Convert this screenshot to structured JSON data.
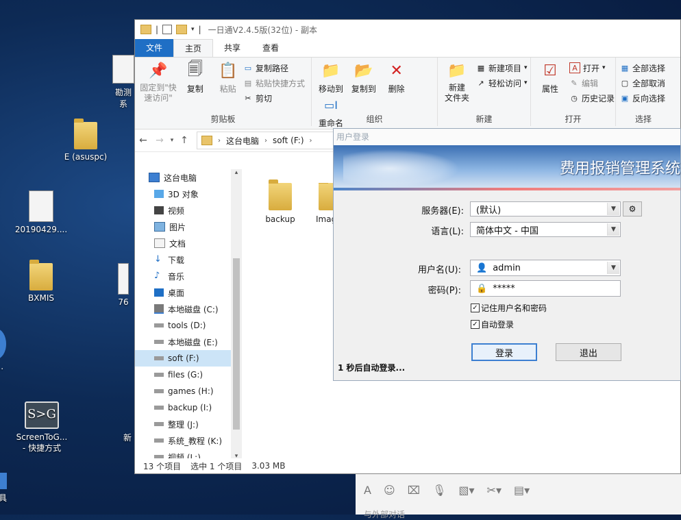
{
  "desktop": {
    "icons": [
      {
        "label": "勘测\n系",
        "kind": "partial"
      },
      {
        "label": "E (asuspc)",
        "kind": "folder"
      },
      {
        "label": "20190429....",
        "kind": "document"
      },
      {
        "label": "BXMIS",
        "kind": "folder"
      },
      {
        "label": "76",
        "kind": "partial"
      },
      {
        "label": "w...",
        "kind": "partial"
      },
      {
        "label": "ScreenToG...\n- 快捷方式",
        "kind": "app"
      },
      {
        "label": "新",
        "kind": "partial"
      },
      {
        "label": "具",
        "kind": "partial"
      }
    ]
  },
  "explorer": {
    "title": "一日通V2.4.5版(32位) - 副本",
    "tabs": [
      "文件",
      "主页",
      "共享",
      "查看"
    ],
    "ribbon": {
      "pin": "固定到\"快\n速访问\"",
      "copy": "复制",
      "paste": "粘贴",
      "copy_path": "复制路径",
      "paste_shortcut": "粘贴快捷方式",
      "cut": "剪切",
      "clipboard": "剪贴板",
      "move_to": "移动到",
      "copy_to": "复制到",
      "delete": "删除",
      "rename": "重命名",
      "organize": "组织",
      "new_folder": "新建\n文件夹",
      "new_item": "新建项目",
      "easy_access": "轻松访问",
      "new_group": "新建",
      "properties": "属性",
      "open": "打开",
      "edit": "编辑",
      "history": "历史记录",
      "open_group": "打开",
      "select_all": "全部选择",
      "select_none": "全部取消",
      "invert": "反向选择",
      "select_group": "选择"
    },
    "address": {
      "parts": [
        "这台电脑",
        "soft (F:)"
      ]
    },
    "nav": [
      {
        "label": "这台电脑",
        "icon": "pc-icon",
        "root": true
      },
      {
        "label": "3D 对象",
        "icon": "cube-icon"
      },
      {
        "label": "视频",
        "icon": "video-icon"
      },
      {
        "label": "图片",
        "icon": "picture-icon"
      },
      {
        "label": "文档",
        "icon": "document-icon"
      },
      {
        "label": "下载",
        "icon": "download-icon"
      },
      {
        "label": "音乐",
        "icon": "music-icon"
      },
      {
        "label": "桌面",
        "icon": "desktop-icon"
      },
      {
        "label": "本地磁盘 (C:)",
        "icon": "windows-drive-icon"
      },
      {
        "label": "tools (D:)",
        "icon": "drive-icon"
      },
      {
        "label": "本地磁盘 (E:)",
        "icon": "drive-icon"
      },
      {
        "label": "soft (F:)",
        "icon": "drive-icon",
        "selected": true
      },
      {
        "label": "files (G:)",
        "icon": "drive-icon"
      },
      {
        "label": "games (H:)",
        "icon": "drive-icon"
      },
      {
        "label": "backup (I:)",
        "icon": "drive-icon"
      },
      {
        "label": "整理 (J:)",
        "icon": "drive-icon"
      },
      {
        "label": "系统_教程 (K:)",
        "icon": "drive-icon"
      },
      {
        "label": "视频 (L:)",
        "icon": "drive-icon"
      }
    ],
    "files": [
      {
        "name": "backup"
      },
      {
        "name": "Imag"
      }
    ],
    "status": {
      "count": "13 个项目",
      "selected": "选中 1 个项目",
      "size": "3.03 MB"
    }
  },
  "login": {
    "title": "用户登录",
    "system_title": "费用报销管理系统",
    "server_label": "服务器(E):",
    "server_value": "(默认)",
    "language_label": "语言(L):",
    "language_value": "简体中文 - 中国",
    "username_label": "用户名(U):",
    "username_value": "admin",
    "password_label": "密码(P):",
    "password_value": "*****",
    "remember_label": "记住用户名和密码",
    "autologin_label": "自动登录",
    "login_button": "登录",
    "exit_button": "退出",
    "countdown": "1 秒后自动登录..."
  },
  "chat": {
    "hint": "与外部对话"
  },
  "colors": {
    "accent": "#1f6fc5",
    "selection": "#cce4f7",
    "desktop": "#0d2a55"
  }
}
